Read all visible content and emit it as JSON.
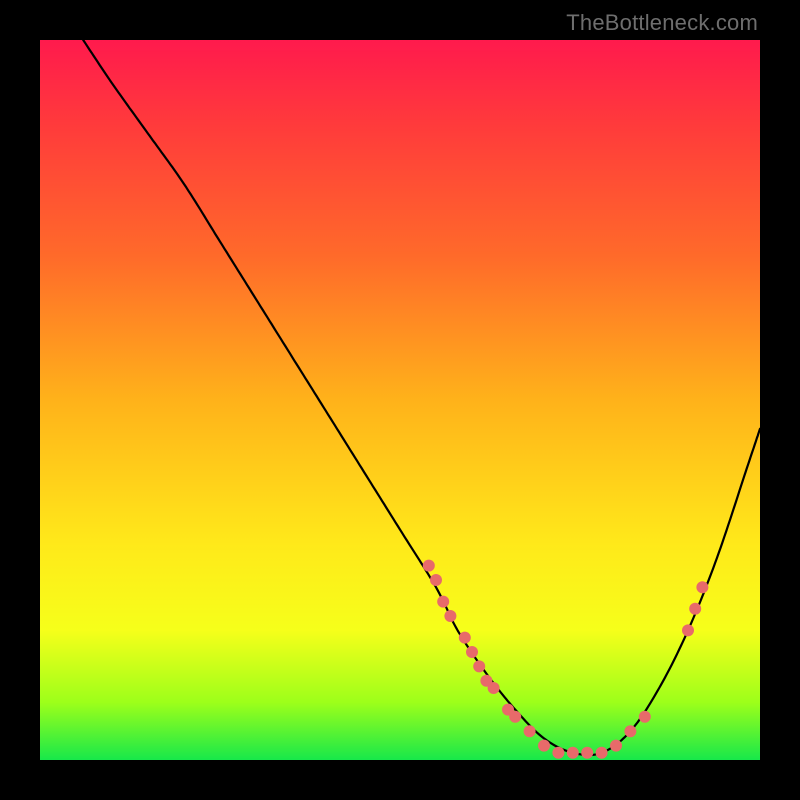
{
  "watermark": "TheBottleneck.com",
  "chart_data": {
    "type": "line",
    "title": "",
    "xlabel": "",
    "ylabel": "",
    "xlim": [
      0,
      100
    ],
    "ylim": [
      0,
      100
    ],
    "grid": false,
    "legend": false,
    "background_gradient": {
      "direction": "vertical",
      "stops": [
        {
          "pos": 0.0,
          "color": "#ff1a4d"
        },
        {
          "pos": 0.3,
          "color": "#ff6a2a"
        },
        {
          "pos": 0.5,
          "color": "#ffb21a"
        },
        {
          "pos": 0.7,
          "color": "#ffe91a"
        },
        {
          "pos": 0.92,
          "color": "#9dff1a"
        },
        {
          "pos": 1.0,
          "color": "#17e84a"
        }
      ]
    },
    "series": [
      {
        "name": "bottleneck-curve",
        "color": "#000000",
        "x": [
          6,
          10,
          15,
          20,
          25,
          30,
          35,
          40,
          45,
          50,
          55,
          58,
          62,
          66,
          70,
          74,
          78,
          82,
          86,
          90,
          94,
          98,
          100
        ],
        "y": [
          100,
          94,
          87,
          80,
          72,
          64,
          56,
          48,
          40,
          32,
          24,
          18,
          12,
          7,
          3,
          1,
          1,
          4,
          10,
          18,
          28,
          40,
          46
        ]
      }
    ],
    "markers": [
      {
        "x": 54,
        "y": 27
      },
      {
        "x": 55,
        "y": 25
      },
      {
        "x": 56,
        "y": 22
      },
      {
        "x": 57,
        "y": 20
      },
      {
        "x": 59,
        "y": 17
      },
      {
        "x": 60,
        "y": 15
      },
      {
        "x": 61,
        "y": 13
      },
      {
        "x": 62,
        "y": 11
      },
      {
        "x": 63,
        "y": 10
      },
      {
        "x": 65,
        "y": 7
      },
      {
        "x": 66,
        "y": 6
      },
      {
        "x": 68,
        "y": 4
      },
      {
        "x": 70,
        "y": 2
      },
      {
        "x": 72,
        "y": 1
      },
      {
        "x": 74,
        "y": 1
      },
      {
        "x": 76,
        "y": 1
      },
      {
        "x": 78,
        "y": 1
      },
      {
        "x": 80,
        "y": 2
      },
      {
        "x": 82,
        "y": 4
      },
      {
        "x": 84,
        "y": 6
      },
      {
        "x": 90,
        "y": 18
      },
      {
        "x": 91,
        "y": 21
      },
      {
        "x": 92,
        "y": 24
      }
    ],
    "marker_style": {
      "shape": "circle",
      "radius_px": 6,
      "color": "#e86a6a"
    }
  }
}
